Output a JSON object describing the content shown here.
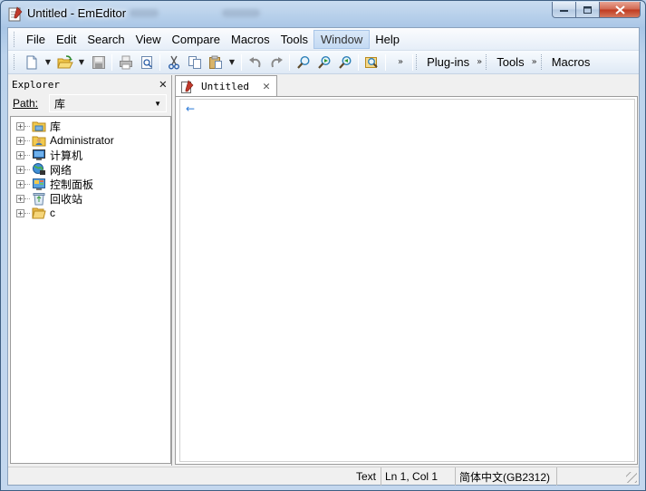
{
  "window": {
    "title": "Untitled - EmEditor",
    "caption": {
      "minimize": "‒",
      "maximize": "□",
      "close": "✕"
    }
  },
  "menu": [
    "File",
    "Edit",
    "Search",
    "View",
    "Compare",
    "Macros",
    "Tools",
    "Window",
    "Help"
  ],
  "menu_active": "Window",
  "toolbar": {
    "buttons": [
      "new-icon",
      "open-icon",
      "save-icon",
      "print-icon",
      "print-preview-icon",
      "cut-icon",
      "copy-icon",
      "paste-icon",
      "undo-icon",
      "redo-icon",
      "find-icon",
      "find-next-icon",
      "find-previous-icon",
      "find-in-files-icon"
    ],
    "labels": {
      "plugins": "Plug-ins",
      "tools": "Tools",
      "macros": "Macros"
    },
    "chevron": "»"
  },
  "explorer": {
    "title": "Explorer",
    "close": "✕",
    "path_label": "Path:",
    "path_value": "库",
    "items": [
      {
        "label": "库",
        "icon": "library-folder-icon"
      },
      {
        "label": "Administrator",
        "icon": "user-folder-icon"
      },
      {
        "label": "计算机",
        "icon": "computer-icon"
      },
      {
        "label": "网络",
        "icon": "network-icon"
      },
      {
        "label": "控制面板",
        "icon": "control-panel-icon"
      },
      {
        "label": "回收站",
        "icon": "recycle-bin-icon"
      },
      {
        "label": "c",
        "icon": "folder-icon"
      }
    ]
  },
  "editor": {
    "tab_title": "Untitled",
    "tab_close": "✕",
    "eof_marker": "←"
  },
  "status": {
    "mode": "Text",
    "position": "Ln 1, Col 1",
    "encoding": "简体中文(GB2312)"
  }
}
